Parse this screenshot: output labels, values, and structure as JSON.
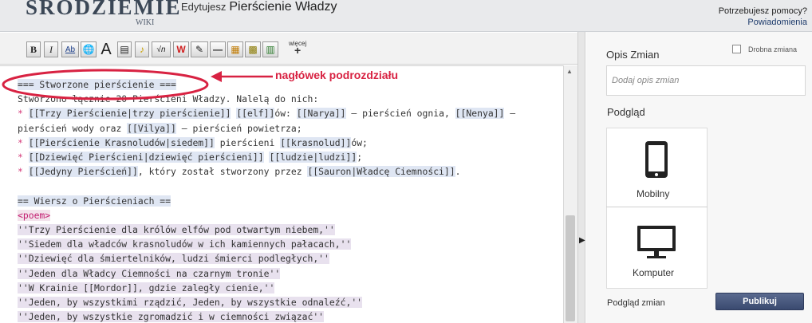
{
  "header": {
    "logo": "ŚRÓDZIEMIE",
    "logo_sub": "WIKI",
    "edit_prefix": "Edytujesz",
    "page_title": "Pierścienie Władzy",
    "help_question": "Potrzebujesz pomocy?",
    "help_link": "Powiadomienia"
  },
  "toolbar": {
    "more_label": "więcej",
    "more_plus": "+",
    "buttons": [
      {
        "name": "bold",
        "label": "B"
      },
      {
        "name": "italic",
        "label": "I"
      },
      {
        "name": "internal-link",
        "label": "Ab"
      },
      {
        "name": "external-link",
        "label": "🌐"
      },
      {
        "name": "headline",
        "label": "A"
      },
      {
        "name": "image",
        "label": "▤"
      },
      {
        "name": "media",
        "label": "♪"
      },
      {
        "name": "math",
        "label": "√n"
      },
      {
        "name": "nowiki",
        "label": "W"
      },
      {
        "name": "signature",
        "label": "✎"
      },
      {
        "name": "hr",
        "label": "—"
      },
      {
        "name": "gallery",
        "label": "▦"
      },
      {
        "name": "template",
        "label": "▩"
      },
      {
        "name": "table",
        "label": "▥"
      }
    ]
  },
  "editor": {
    "lines": [
      {
        "segments": [
          {
            "t": "=== Stworzone pierścienie ===",
            "c": "hl"
          }
        ]
      },
      {
        "segments": [
          {
            "t": "Stworzono łącznie 20 Pierścieni Władzy. Nalelą do nich:"
          }
        ]
      },
      {
        "segments": [
          {
            "t": "* ",
            "c": "star"
          },
          {
            "t": "[[Trzy Pierścienie|trzy pierścienie]]",
            "c": "hl"
          },
          {
            "t": " "
          },
          {
            "t": "[[elf]]",
            "c": "hl"
          },
          {
            "t": "ów: "
          },
          {
            "t": "[[Narya]]",
            "c": "hl"
          },
          {
            "t": " – pierścień ognia, "
          },
          {
            "t": "[[Nenya]]",
            "c": "hl"
          },
          {
            "t": " –"
          }
        ]
      },
      {
        "segments": [
          {
            "t": "pierścień wody oraz "
          },
          {
            "t": "[[Vilya]]",
            "c": "hl"
          },
          {
            "t": " – pierścień powietrza;"
          }
        ]
      },
      {
        "segments": [
          {
            "t": "* ",
            "c": "star"
          },
          {
            "t": "[[Pierścienie Krasnoludów|siedem]]",
            "c": "hl"
          },
          {
            "t": " pierścieni "
          },
          {
            "t": "[[krasnolud]]",
            "c": "hl"
          },
          {
            "t": "ów;"
          }
        ]
      },
      {
        "segments": [
          {
            "t": "* ",
            "c": "star"
          },
          {
            "t": "[[Dziewięć Pierścieni|dziewięć pierścieni]]",
            "c": "hl"
          },
          {
            "t": " "
          },
          {
            "t": "[[ludzie|ludzi]]",
            "c": "hl"
          },
          {
            "t": ";"
          }
        ]
      },
      {
        "segments": [
          {
            "t": "* ",
            "c": "star"
          },
          {
            "t": "[[Jedyny Pierścień]]",
            "c": "hl"
          },
          {
            "t": ", który został stworzony przez "
          },
          {
            "t": "[[Sauron|Władcę Ciemności]]",
            "c": "hl"
          },
          {
            "t": "."
          }
        ]
      },
      {
        "segments": [
          {
            "t": ""
          }
        ]
      },
      {
        "segments": [
          {
            "t": "== Wiersz o Pierścieniach ==",
            "c": "hl"
          }
        ]
      },
      {
        "segments": [
          {
            "t": "<poem>",
            "c": "tag"
          }
        ]
      },
      {
        "segments": [
          {
            "t": "''Trzy Pierścienie dla królów elfów pod otwartym niebem,''",
            "c": "hl2"
          }
        ]
      },
      {
        "segments": [
          {
            "t": "''Siedem dla władców krasnoludów w ich kamiennych pałacach,''",
            "c": "hl2"
          }
        ]
      },
      {
        "segments": [
          {
            "t": "''Dziewięć dla śmiertelników, ludzi śmierci podległych,''",
            "c": "hl2"
          }
        ]
      },
      {
        "segments": [
          {
            "t": "''Jeden dla Władcy Ciemności na czarnym tronie''",
            "c": "hl2"
          }
        ]
      },
      {
        "segments": [
          {
            "t": "''W Krainie [[Mordor]], gdzie zaległy cienie,''",
            "c": "hl2"
          }
        ]
      },
      {
        "segments": [
          {
            "t": "''Jeden, by wszystkimi rządzić, Jeden, by wszystkie odnaleźć,''",
            "c": "hl2"
          }
        ]
      },
      {
        "segments": [
          {
            "t": "''Jeden, by wszystkie zgromadzić i w ciemności związać''",
            "c": "hl2"
          }
        ]
      }
    ]
  },
  "annotation": {
    "text": "nagłówek podrozdziału",
    "color": "#d82242"
  },
  "panel": {
    "summary_label": "Opis Zmian",
    "minor_edit_label": "Drobna zmiana",
    "summary_placeholder": "Dodaj opis zmian",
    "preview_label": "Podgląd",
    "mobile_label": "Mobilny",
    "desktop_label": "Komputer",
    "preview_changes": "Podgląd zmian",
    "publish": "Publikuj"
  },
  "colors": {
    "accent": "#3a4a70",
    "wikilink_highlight": "#dfe6f3",
    "annotation": "#d82242"
  }
}
